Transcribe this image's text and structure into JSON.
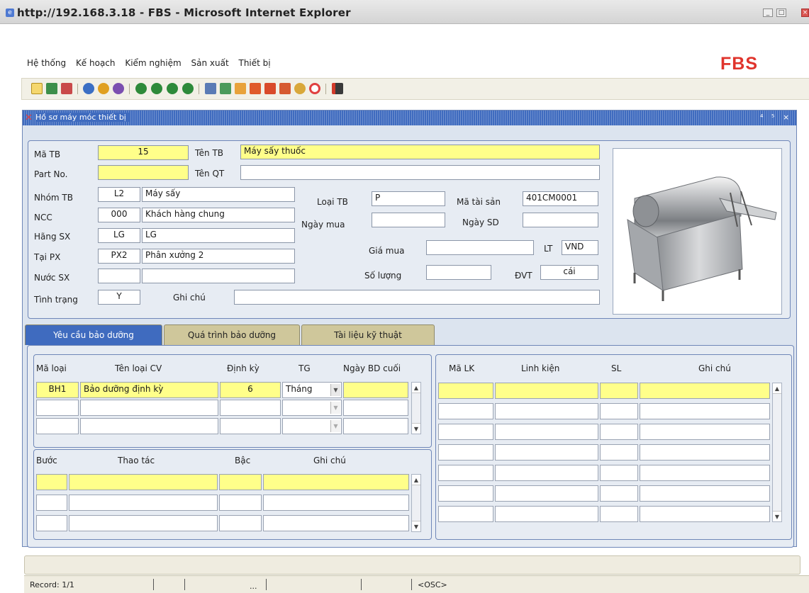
{
  "window": {
    "title": "http://192.168.3.18 - FBS - Microsoft Internet Explorer",
    "brand": "FBS"
  },
  "menu": [
    "Hệ thống",
    "Kế hoạch",
    "Kiểm nghiệm",
    "Sản xuất",
    "Thiết bị"
  ],
  "toolbar": {
    "icons": [
      "new-icon",
      "save-icon",
      "delete-icon",
      "search-icon",
      "search-execute-icon",
      "search-clear-icon",
      "first-record-icon",
      "previous-record-icon",
      "next-record-icon",
      "last-record-icon",
      "print-icon",
      "export-icon",
      "tool-1-icon",
      "tool-2-icon",
      "tool-3-icon",
      "tool-4-icon",
      "users-icon",
      "help-icon",
      "exit-icon"
    ]
  },
  "form": {
    "title": "Hồ sơ máy móc thiết bị",
    "controls": [
      "⁴",
      "⁵",
      "×"
    ]
  },
  "header": {
    "ma_tb": {
      "label": "Mã TB",
      "value": "15"
    },
    "ten_tb": {
      "label": "Tên TB",
      "value": "Máy sấy thuốc"
    },
    "part_no": {
      "label": "Part No.",
      "value": ""
    },
    "ten_qt": {
      "label": "Tên QT",
      "value": ""
    },
    "nhom_tb": {
      "label": "Nhóm TB",
      "code": "L2",
      "value": "Máy sấy"
    },
    "ncc": {
      "label": "NCC",
      "code": "000",
      "value": "Khách hàng chung"
    },
    "hang_sx": {
      "label": "Hãng SX",
      "code": "LG",
      "value": "LG"
    },
    "tai_px": {
      "label": "Tại PX",
      "code": "PX2",
      "value": "Phân xưởng 2"
    },
    "nuoc_sx": {
      "label": "Nước SX",
      "code": "",
      "value": ""
    },
    "tinh_trang": {
      "label": "Tình trạng",
      "value": "Y"
    },
    "ghi_chu": {
      "label": "Ghi chú",
      "value": ""
    },
    "loai_tb": {
      "label": "Loại TB",
      "value": "P"
    },
    "ma_tai_san": {
      "label": "Mã tài sản",
      "value": "401CM0001"
    },
    "ngay_mua": {
      "label": "Ngày mua",
      "value": ""
    },
    "ngay_sd": {
      "label": "Ngày SD",
      "value": ""
    },
    "gia_mua": {
      "label": "Giá mua",
      "value": ""
    },
    "lt": {
      "label": "LT",
      "value": "VND"
    },
    "so_luong": {
      "label": "Số lượng",
      "value": ""
    },
    "dvt": {
      "label": "ĐVT",
      "value": "cái"
    }
  },
  "tabs": [
    {
      "label": "Yêu cầu bảo dưỡng"
    },
    {
      "label": "Quá trình bảo dưỡng"
    },
    {
      "label": "Tài liệu kỹ thuật"
    }
  ],
  "maintenance": {
    "headers": [
      "Mã loại",
      "Tên loại CV",
      "Định kỳ",
      "TG",
      "Ngày BD cuối"
    ],
    "rows": [
      {
        "ma_loai": "BH1",
        "ten_loai": "Bảo dưỡng định kỳ",
        "dinh_ky": "6",
        "tg": "Tháng",
        "ngay": ""
      },
      {
        "ma_loai": "",
        "ten_loai": "",
        "dinh_ky": "",
        "tg": "",
        "ngay": ""
      },
      {
        "ma_loai": "",
        "ten_loai": "",
        "dinh_ky": "",
        "tg": "",
        "ngay": ""
      }
    ]
  },
  "steps": {
    "headers": [
      "Bước",
      "Thao tác",
      "Bậc",
      "Ghi chú"
    ]
  },
  "parts": {
    "headers": [
      "Mã LK",
      "Linh kiện",
      "SL",
      "Ghi chú"
    ]
  },
  "status": {
    "record": "Record: 1/1",
    "dots": "...",
    "mode": "<OSC>"
  }
}
